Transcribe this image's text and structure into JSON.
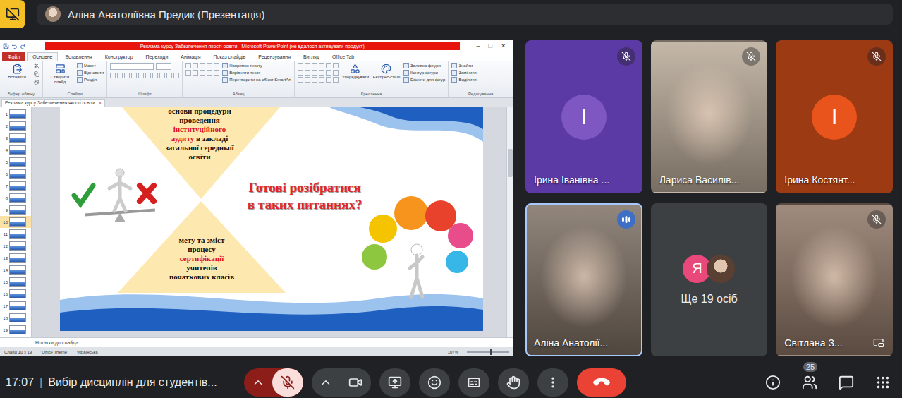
{
  "topbar": {
    "presenter": "Аліна Анатоліївна Предик (Презентація)"
  },
  "presentation": {
    "window_title": "Реклама курсу Забезпечення якості освіти - Microsoft PowerPoint (не вдалося активувати продукт)",
    "window_controls": [
      "–",
      "□",
      "✕"
    ],
    "ribbon_tabs": [
      {
        "label": "Файл",
        "kind": "file",
        "selected": false
      },
      {
        "label": "Основне",
        "kind": "tab",
        "selected": true
      },
      {
        "label": "Вставлення",
        "kind": "tab",
        "selected": false
      },
      {
        "label": "Конструктор",
        "kind": "tab",
        "selected": false
      },
      {
        "label": "Переходи",
        "kind": "tab",
        "selected": false
      },
      {
        "label": "Анімація",
        "kind": "tab",
        "selected": false
      },
      {
        "label": "Показ слайдів",
        "kind": "tab",
        "selected": false
      },
      {
        "label": "Рецензування",
        "kind": "tab",
        "selected": false
      },
      {
        "label": "Вигляд",
        "kind": "tab",
        "selected": false
      },
      {
        "label": "Office Tab",
        "kind": "tab",
        "selected": false
      }
    ],
    "ribbon_groups": [
      {
        "label": "Буфер обміну",
        "kind": "clipboard",
        "buttons": [
          {
            "label": "Вставити",
            "kind": "large"
          }
        ]
      },
      {
        "label": "Слайди",
        "kind": "slides",
        "buttons": [
          {
            "label": "Створити слайд",
            "kind": "large"
          },
          {
            "label": "Макет",
            "kind": "small"
          },
          {
            "label": "Відновити",
            "kind": "small"
          },
          {
            "label": "Розділ",
            "kind": "small"
          }
        ]
      },
      {
        "label": "Шрифт",
        "kind": "font",
        "buttons": []
      },
      {
        "label": "Абзац",
        "kind": "paragraph",
        "buttons": [
          {
            "label": "Напрямок тексту",
            "kind": "small"
          },
          {
            "label": "Вирівняти текст",
            "kind": "small"
          },
          {
            "label": "Перетворити на об'єкт SmartArt",
            "kind": "small"
          }
        ]
      },
      {
        "label": "Креслення",
        "kind": "drawing",
        "buttons": [
          {
            "label": "Упорядкувати",
            "kind": "large"
          },
          {
            "label": "Експрес-стилі",
            "kind": "large"
          },
          {
            "label": "Заливка фігури",
            "kind": "small"
          },
          {
            "label": "Контур фігури",
            "kind": "small"
          },
          {
            "label": "Ефекти для фігур",
            "kind": "small"
          }
        ]
      },
      {
        "label": "Редагування",
        "kind": "editing",
        "buttons": [
          {
            "label": "Знайти",
            "kind": "small"
          },
          {
            "label": "Замінити",
            "kind": "small"
          },
          {
            "label": "Виділити",
            "kind": "small"
          }
        ]
      }
    ],
    "document_tab": {
      "label": "Реклама курсу Забезпечення якості освіти",
      "close": "×"
    },
    "slides": [
      {
        "number": "1",
        "selected": false
      },
      {
        "number": "2",
        "selected": false
      },
      {
        "number": "3",
        "selected": false
      },
      {
        "number": "4",
        "selected": false
      },
      {
        "number": "5",
        "selected": false
      },
      {
        "number": "6",
        "selected": false
      },
      {
        "number": "7",
        "selected": false
      },
      {
        "number": "8",
        "selected": false
      },
      {
        "number": "9",
        "selected": false
      },
      {
        "number": "10",
        "selected": true
      },
      {
        "number": "11",
        "selected": false
      },
      {
        "number": "12",
        "selected": false
      },
      {
        "number": "13",
        "selected": false
      },
      {
        "number": "14",
        "selected": false
      },
      {
        "number": "15",
        "selected": false
      },
      {
        "number": "16",
        "selected": false
      },
      {
        "number": "17",
        "selected": false
      },
      {
        "number": "18",
        "selected": false
      },
      {
        "number": "19",
        "selected": false
      }
    ],
    "slide": {
      "title_lines": [
        "Готові розібратися",
        "в таких питаннях?"
      ],
      "top_lines": [
        [
          {
            "text": "основи процедури",
            "highlight": false
          }
        ],
        [
          {
            "text": "проведення",
            "highlight": false
          }
        ],
        [
          {
            "text": "інституційного",
            "highlight": true
          }
        ],
        [
          {
            "text": "аудиту",
            "highlight": true
          },
          {
            "text": " в закладі",
            "highlight": false
          }
        ],
        [
          {
            "text": "загальної середньої",
            "highlight": false
          }
        ],
        [
          {
            "text": "освіти",
            "highlight": false
          }
        ]
      ],
      "bottom_lines": [
        [
          {
            "text": "мету та зміст",
            "highlight": false
          }
        ],
        [
          {
            "text": "процесу",
            "highlight": false
          }
        ],
        [
          {
            "text": "сертифікації",
            "highlight": true
          }
        ],
        [
          {
            "text": "учителів",
            "highlight": false
          }
        ],
        [
          {
            "text": "початкових класів",
            "highlight": false
          }
        ]
      ]
    },
    "notes_placeholder": "Нотатки до слайда",
    "status": {
      "slide": "Слайд 10 з 19",
      "theme": "\"Office Theme\"",
      "language": "українська",
      "zoom": "107%",
      "zoom_level": 0.55
    }
  },
  "tiles": [
    {
      "kind": "avatar",
      "name": "Ірина Іванівна ...",
      "initial": "І",
      "color": "#5b3aa6",
      "avatar_color": "#7e57c2",
      "muted": true,
      "speaking": false,
      "pip": false
    },
    {
      "kind": "photo",
      "name": "Лариса Василів...",
      "initial": "",
      "color": "#b7a896",
      "avatar_color": "#b7a896",
      "muted": true,
      "speaking": false,
      "pip": false
    },
    {
      "kind": "avatar",
      "name": "Ірина Костянт...",
      "initial": "І",
      "color": "#9c3a14",
      "avatar_color": "#e8541c",
      "muted": true,
      "speaking": false,
      "pip": false
    },
    {
      "kind": "photo",
      "name": "Аліна Анатолії...",
      "initial": "",
      "color": "#7a6c60",
      "avatar_color": "#7a6c60",
      "muted": false,
      "speaking": true,
      "pip": false
    },
    {
      "kind": "more",
      "name": "Ще 19 осіб",
      "initial": "Я",
      "color": "#3c4043",
      "avatar_color": "#e8497a",
      "muted": false,
      "speaking": false,
      "pip": false
    },
    {
      "kind": "photo",
      "name": "Світлана З...",
      "initial": "",
      "color": "#8b7262",
      "avatar_color": "#8b7262",
      "muted": true,
      "speaking": false,
      "pip": true
    }
  ],
  "bottombar": {
    "time": "17:07",
    "separator": "|",
    "meeting": "Вибір дисциплін для студентів...",
    "controls": [
      {
        "kind": "mic",
        "has_menu": true,
        "off": true
      },
      {
        "kind": "camera",
        "has_menu": true,
        "off": false
      },
      {
        "kind": "present",
        "has_menu": false,
        "off": false
      },
      {
        "kind": "reactions",
        "has_menu": false,
        "off": false
      },
      {
        "kind": "captions",
        "has_menu": false,
        "off": false
      },
      {
        "kind": "hand",
        "has_menu": false,
        "off": false
      },
      {
        "kind": "more",
        "has_menu": false,
        "off": false
      },
      {
        "kind": "leave",
        "has_menu": false,
        "off": false
      }
    ],
    "side_controls": [
      {
        "kind": "info"
      },
      {
        "kind": "people",
        "badge": "25"
      },
      {
        "kind": "chat"
      },
      {
        "kind": "activities"
      }
    ]
  }
}
